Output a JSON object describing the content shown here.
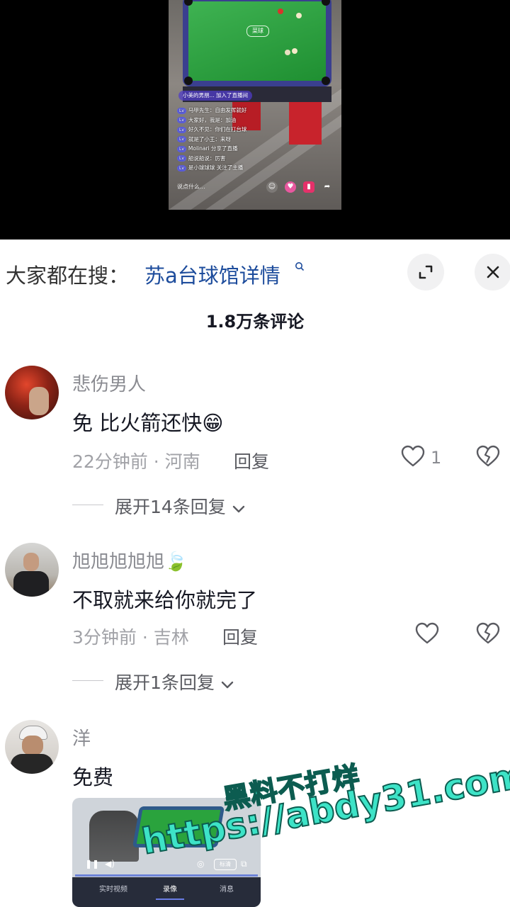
{
  "video": {
    "live_join_text": "小美的男朋... 加入了直播间",
    "live_chat": [
      {
        "badge": "Lv",
        "text": "马甲先生：自由发挥就好"
      },
      {
        "badge": "Lv",
        "text": "大家好，我是：加油"
      },
      {
        "badge": "Lv",
        "text": "好久不见：你们在打台球"
      },
      {
        "badge": "Lv",
        "text": "就是了小王：来呀"
      },
      {
        "badge": "Lv",
        "text": "Molinari 分享了直播"
      },
      {
        "badge": "Lv",
        "text": "船说船说：厉害"
      },
      {
        "badge": "Lv",
        "text": "是小球球球 关注了主播"
      }
    ],
    "live_say_placeholder": "说点什么...",
    "table_logo_text": "菜球"
  },
  "search": {
    "prefix": "大家都在搜：",
    "term": "苏a台球馆详情"
  },
  "comments_header": {
    "count_label": "1.8万条评论"
  },
  "comments": [
    {
      "username": "悲伤男人",
      "text": "免 比火箭还快😁",
      "time_location": "22分钟前 · 河南",
      "reply_label": "回复",
      "like_count": "1",
      "expand_label": "展开14条回复"
    },
    {
      "username": "旭旭旭旭旭🍃",
      "text": "不取就来给你就完了",
      "time_location": "3分钟前 · 吉林",
      "reply_label": "回复",
      "like_count": "",
      "expand_label": "展开1条回复"
    },
    {
      "username": "洋",
      "text": "免费",
      "time_location": "",
      "reply_label": "",
      "like_count": "",
      "expand_label": ""
    }
  ],
  "comment_image": {
    "tabs": [
      "实时视频",
      "录像",
      "消息"
    ],
    "active_tab": "录像",
    "pill_text": "标清"
  },
  "watermark": {
    "line1": "黑料不打烊",
    "line2": "https://abdy31.com"
  },
  "icons": [
    "expand-icon",
    "close-icon",
    "heart-icon",
    "broken-heart-icon",
    "chevron-down-icon",
    "search-icon"
  ],
  "colors": {
    "search_term": "#1d4c9c",
    "watermark": "#3de3c7",
    "pool_cloth": "#24a83a"
  }
}
